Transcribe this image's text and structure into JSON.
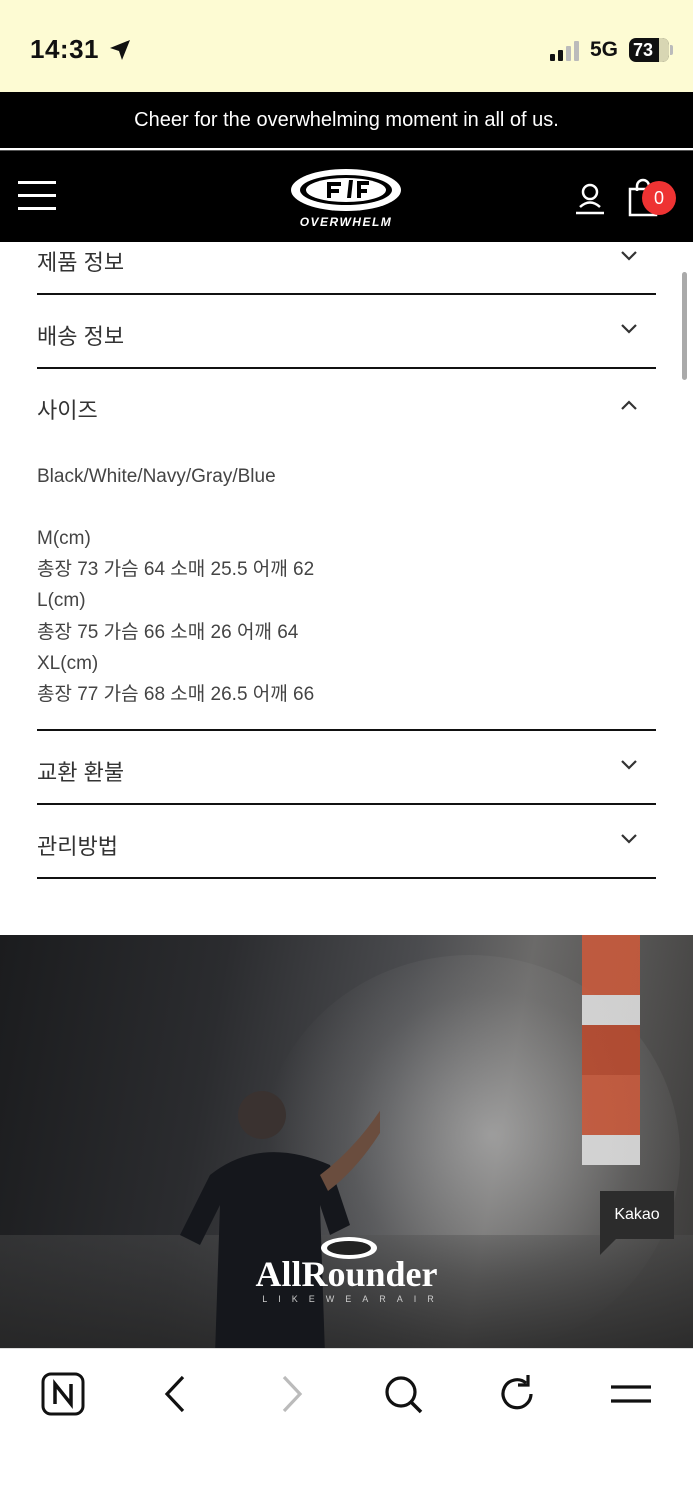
{
  "status_bar": {
    "time": "14:31",
    "network": "5G",
    "battery": "73"
  },
  "announcement": "Cheer for the overwhelming moment in all of us.",
  "header": {
    "logo_text": "OVERWHELM",
    "cart_count": "0"
  },
  "accordion": [
    {
      "label": "제품 정보",
      "expanded": false
    },
    {
      "label": "배송 정보",
      "expanded": false
    },
    {
      "label": "사이즈",
      "expanded": true
    },
    {
      "label": "교환 환불",
      "expanded": false
    },
    {
      "label": "관리방법",
      "expanded": false
    }
  ],
  "size_info": {
    "colors": "Black/White/Navy/Gray/Blue",
    "lines": [
      "M(cm)",
      "총장 73 가슴 64 소매 25.5 어깨 62",
      "L(cm)",
      "총장 75 가슴 66 소매 26 어깨 64",
      "XL(cm)",
      "총장 77 가슴 68 소매 26.5 어깨 66"
    ]
  },
  "banner": {
    "title": "AllRounder",
    "subtitle": "LIKEWEARAIR"
  },
  "kakao_label": "Kakao",
  "toolbar": {
    "icons": [
      "naver-icon",
      "back-icon",
      "forward-icon",
      "search-icon",
      "reload-icon",
      "menu-icon"
    ]
  }
}
